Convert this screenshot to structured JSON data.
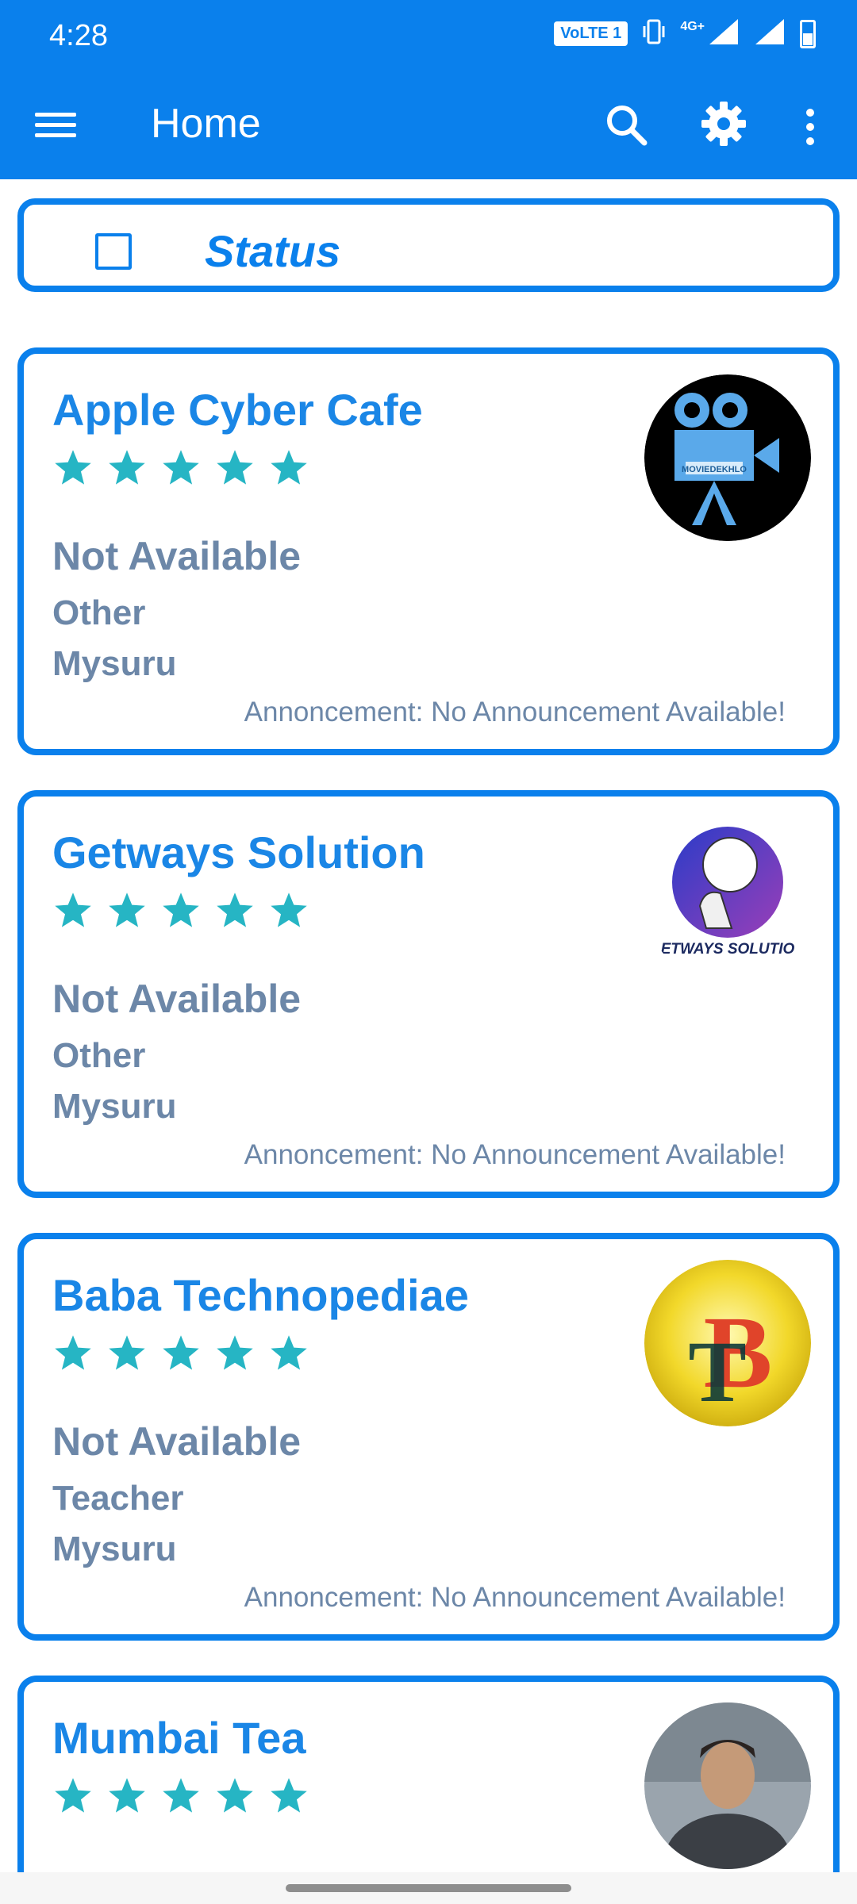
{
  "status_bar": {
    "time": "4:28",
    "volte": "VoLTE 1",
    "network": "4G+"
  },
  "app_bar": {
    "title": "Home",
    "icons": [
      "menu-icon",
      "search-icon",
      "gear-icon",
      "more-vert-icon"
    ]
  },
  "filter": {
    "label": "Status",
    "checked": false
  },
  "colors": {
    "primary": "#0a80ec",
    "star": "#26b5c4",
    "muted_text": "#6c87a8"
  },
  "listings": [
    {
      "name": "Apple Cyber Cafe",
      "rating": 5,
      "status": "Not Available",
      "category": "Other",
      "city": "Mysuru",
      "announcement": "Annoncement: No Announcement Available!",
      "avatar_text": "MOVIEDEKHLO"
    },
    {
      "name": "Getways Solution",
      "rating": 5,
      "status": "Not Available",
      "category": "Other",
      "city": "Mysuru",
      "announcement": "Annoncement: No Announcement Available!",
      "avatar_text": "ETWAYS SOLUTIO"
    },
    {
      "name": "Baba Technopediae",
      "rating": 5,
      "status": "Not Available",
      "category": "Teacher",
      "city": "Mysuru",
      "announcement": "Annoncement: No Announcement Available!",
      "avatar_text": "BT"
    },
    {
      "name": "Mumbai Tea",
      "rating": 5
    }
  ]
}
